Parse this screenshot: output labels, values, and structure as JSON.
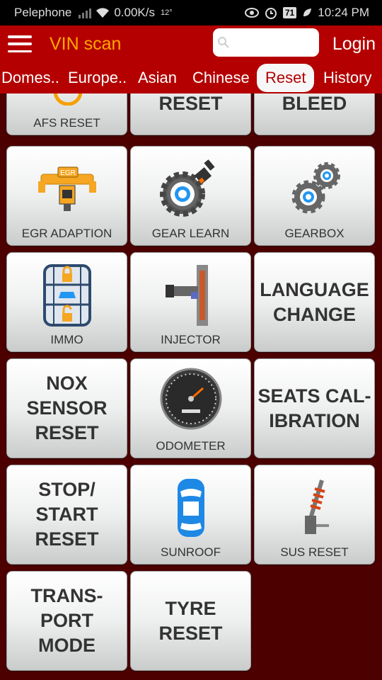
{
  "status_bar": {
    "carrier": "Pelephone",
    "speed": "0.00K/s",
    "temp": "12°",
    "battery": "71",
    "time": "10:24 PM"
  },
  "app_bar": {
    "title": "VIN scan",
    "search_placeholder": "",
    "login_label": "Login"
  },
  "tabs": [
    {
      "label": "Domes..",
      "active": false
    },
    {
      "label": "Europe..",
      "active": false
    },
    {
      "label": "Asian",
      "active": false
    },
    {
      "label": "Chinese",
      "active": false
    },
    {
      "label": "Reset",
      "active": true
    },
    {
      "label": "History",
      "active": false
    }
  ],
  "tiles": [
    {
      "label": "AFS RESET",
      "type": "icon",
      "icon": "afs-icon"
    },
    {
      "label": "RESET",
      "type": "cut"
    },
    {
      "label": "BLEED",
      "type": "cut"
    },
    {
      "label": "EGR ADAPTION",
      "type": "icon",
      "icon": "egr-icon",
      "icon_text": "EGR"
    },
    {
      "label": "GEAR LEARN",
      "type": "icon",
      "icon": "gear-learn-icon"
    },
    {
      "label": "GEARBOX",
      "type": "icon",
      "icon": "gearbox-icon"
    },
    {
      "label": "IMMO",
      "type": "icon",
      "icon": "immo-icon"
    },
    {
      "label": "INJECTOR",
      "type": "icon",
      "icon": "injector-icon"
    },
    {
      "label": "LANGUAGE CHANGE",
      "lines": [
        "LANGUAGE",
        "CHANGE"
      ],
      "type": "text"
    },
    {
      "label": "NOX SENSOR RESET",
      "lines": [
        "NOX",
        "SENSOR",
        "RESET"
      ],
      "type": "text"
    },
    {
      "label": "ODOMETER",
      "type": "icon",
      "icon": "odometer-icon"
    },
    {
      "label": "SEATS CALIBRATION",
      "lines": [
        "SEATS CAL-",
        "IBRATION"
      ],
      "type": "text"
    },
    {
      "label": "STOP/START RESET",
      "lines": [
        "STOP/",
        "START",
        "RESET"
      ],
      "type": "text"
    },
    {
      "label": "SUNROOF",
      "type": "icon",
      "icon": "sunroof-icon"
    },
    {
      "label": "SUS RESET",
      "type": "icon",
      "icon": "suspension-icon"
    },
    {
      "label": "TRANSPORT MODE",
      "lines": [
        "TRANS-",
        "PORT",
        "MODE"
      ],
      "type": "text"
    },
    {
      "label": "TYRE RESET",
      "lines": [
        "TYRE",
        "RESET"
      ],
      "type": "text"
    }
  ],
  "colors": {
    "app_bar": "#b40000",
    "title_accent": "#ffa800",
    "background": "#4d0000",
    "tile_text": "#333333"
  }
}
